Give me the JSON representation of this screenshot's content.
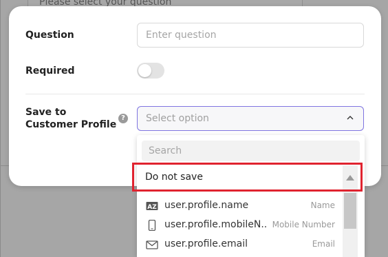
{
  "background": {
    "question_text": "Please select your question"
  },
  "form": {
    "question_label": "Question",
    "question_placeholder": "Enter question",
    "required_label": "Required",
    "required_on": false,
    "save_label": "Save to Customer Profile",
    "select_placeholder": "Select option"
  },
  "dropdown": {
    "search_placeholder": "Search",
    "do_not_save": "Do not save",
    "fields": [
      {
        "name": "user.profile.name",
        "type": "Name",
        "icon": "text-az-icon"
      },
      {
        "name": "user.profile.mobileN...",
        "type": "Mobile Number",
        "icon": "mobile-phone-icon"
      },
      {
        "name": "user.profile.email",
        "type": "Email",
        "icon": "envelope-icon"
      }
    ]
  },
  "colors": {
    "highlight": "#e0232f",
    "focus_border": "#7e74e0"
  }
}
